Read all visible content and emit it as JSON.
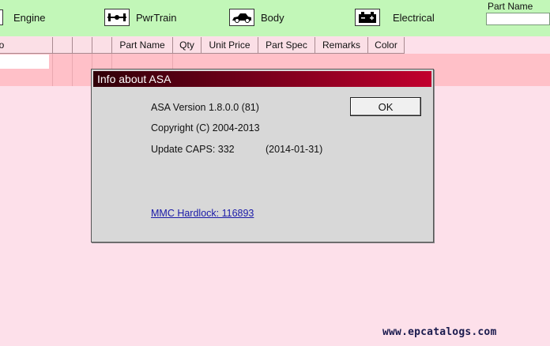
{
  "toolbar": {
    "categories": [
      {
        "label": "Engine",
        "icon": "engine-icon"
      },
      {
        "label": "PwrTrain",
        "icon": "powertrain-icon"
      },
      {
        "label": "Body",
        "icon": "car-body-icon"
      },
      {
        "label": "Electrical",
        "icon": "battery-icon"
      }
    ],
    "part_name_label": "Part Name",
    "part_name_value": ""
  },
  "grid": {
    "columns": [
      "lo",
      "",
      "",
      "",
      "Part Name",
      "Qty",
      "Unit Price",
      "Part Spec",
      "Remarks",
      "Color"
    ]
  },
  "dialog": {
    "title": "Info about ASA",
    "version": "ASA Version 1.8.0.0 (81)",
    "copyright": "Copyright (C) 2004-2013",
    "update_caps": "Update CAPS: 332",
    "update_date": "(2014-01-31)",
    "hardlock_link": "MMC Hardlock: 116893",
    "ok_label": "OK"
  },
  "watermark": "www.epcatalogs.com",
  "colors": {
    "toolbar_bg": "#c2f7b8",
    "page_bg": "#fde0ea",
    "row_bg": "#ffc0c8",
    "title_gradient_start": "#300008",
    "title_gradient_end": "#c2002e",
    "link": "#1a1aa8"
  }
}
